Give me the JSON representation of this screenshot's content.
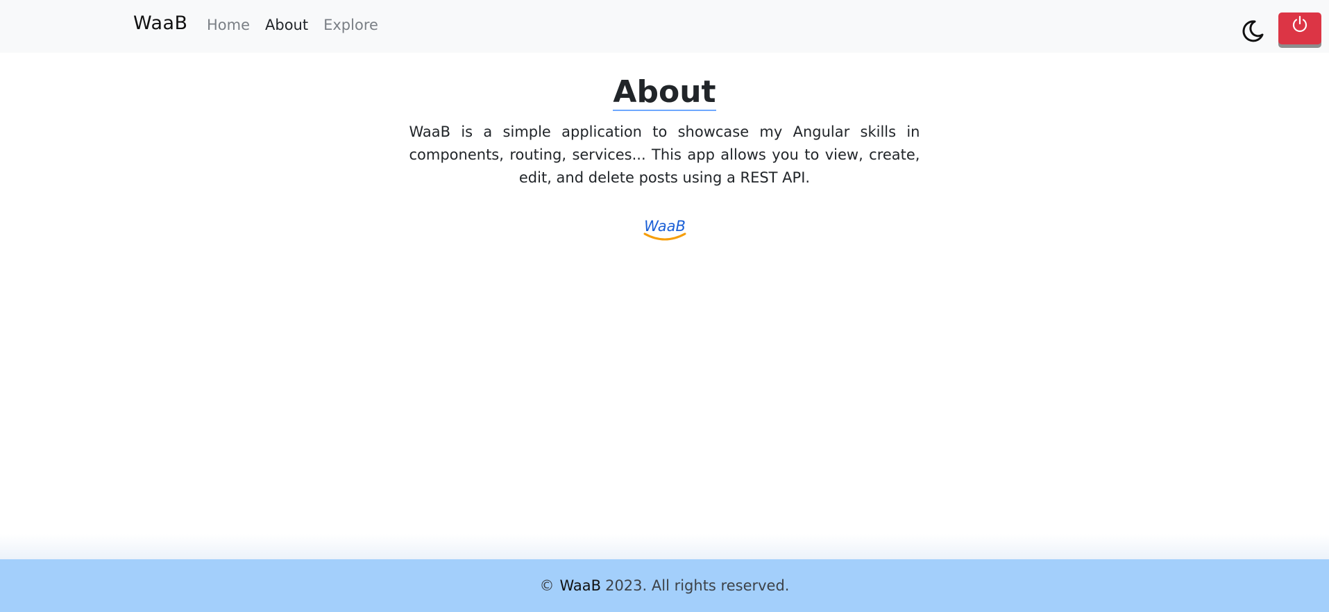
{
  "navbar": {
    "brand": "WaaB",
    "links": [
      {
        "label": "Home",
        "active": false
      },
      {
        "label": "About",
        "active": true
      },
      {
        "label": "Explore",
        "active": false
      }
    ],
    "theme_toggle_icon": "moon-icon",
    "logout_icon": "power-icon",
    "logout_color": "#dc3545"
  },
  "main": {
    "title": "About",
    "description": "WaaB is a simple application to showcase my Angular skills in components, routing, services... This app allows you to view, create, edit, and delete posts using a REST API.",
    "logo_text": "WaaB",
    "logo_text_color": "#1a5fd6",
    "logo_smile_color": "#f59e0b"
  },
  "footer": {
    "copyright_symbol": "©",
    "brand": "WaaB",
    "text": "2023. All rights reserved.",
    "background": "#a3cffb"
  }
}
